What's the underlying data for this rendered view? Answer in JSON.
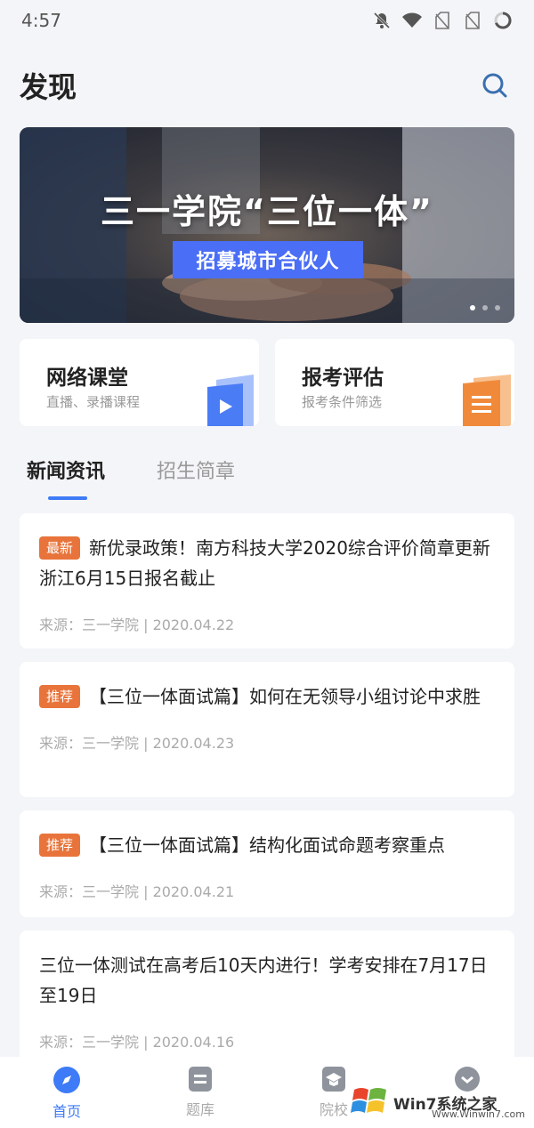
{
  "status_bar": {
    "time": "4:57",
    "icons": [
      "bell-off-icon",
      "wifi-icon",
      "no-sim-icon",
      "no-sim-icon",
      "battery-ring-icon"
    ]
  },
  "header": {
    "title": "发现",
    "search_icon": "search-icon"
  },
  "banner": {
    "headline": "三一学院“三位一体”",
    "tag": "招募城市合伙人",
    "dots": 3,
    "active_dot": 1
  },
  "cards": [
    {
      "title": "网络课堂",
      "subtitle": "直播、录播课程",
      "icon": "video-play-icon",
      "color": "#4a7cf5"
    },
    {
      "title": "报考评估",
      "subtitle": "报考条件筛选",
      "icon": "document-list-icon",
      "color": "#f08a3a"
    }
  ],
  "tabs": [
    {
      "label": "新闻资讯",
      "active": true
    },
    {
      "label": "招生简章",
      "active": false
    }
  ],
  "news": [
    {
      "badge": "最新",
      "title": "新优录政策！南方科技大学2020综合评价简章更新 浙江6月15日报名截止",
      "meta": "来源：三一学院 | 2020.04.22"
    },
    {
      "badge": "推荐",
      "title": "【三位一体面试篇】如何在无领导小组讨论中求胜",
      "meta": "来源：三一学院 | 2020.04.23"
    },
    {
      "badge": "推荐",
      "title": "【三位一体面试篇】结构化面试命题考察重点",
      "meta": "来源：三一学院 | 2020.04.21"
    },
    {
      "badge": "",
      "title": "三位一体测试在高考后10天内进行！学考安排在7月17日至19日",
      "meta": "来源：三一学院 | 2020.04.16"
    }
  ],
  "bottom_nav": [
    {
      "label": "首页",
      "icon": "compass-icon",
      "active": true
    },
    {
      "label": "题库",
      "icon": "question-bank-icon",
      "active": false
    },
    {
      "label": "院校",
      "icon": "school-icon",
      "active": false
    },
    {
      "label": "",
      "icon": "profile-icon",
      "active": false
    }
  ],
  "watermark": {
    "brand": "Win7系统之家",
    "url": "Www.Winwin7.com"
  },
  "colors": {
    "accent": "#3d7bf7",
    "badge": "#e8743b",
    "banner_tag": "#4a6ef5"
  }
}
